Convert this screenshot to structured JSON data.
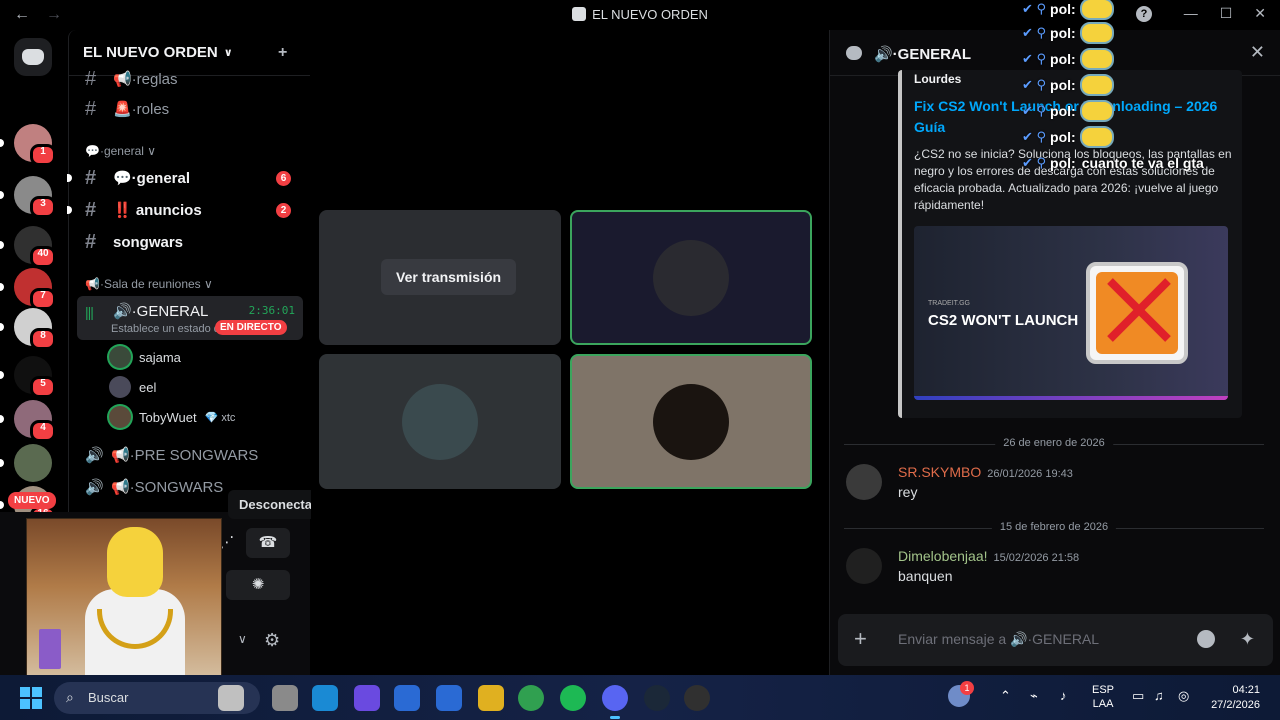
{
  "window": {
    "title": "EL NUEVO ORDEN",
    "back": "←",
    "forward": "→",
    "help": "?",
    "minimize": "—",
    "maximize": "☐",
    "close": "✕"
  },
  "rail": {
    "servers": [
      {
        "badge": "",
        "color": "#5865f2"
      },
      {
        "badge": "1",
        "color": "#c08080"
      },
      {
        "badge": "3",
        "color": "#8a8a8a"
      },
      {
        "badge": "40",
        "color": "#303030"
      },
      {
        "badge": "7",
        "color": "#c03030"
      },
      {
        "badge": "8",
        "color": "#d0d0d0"
      },
      {
        "badge": "5",
        "color": "#101010"
      },
      {
        "badge": "4",
        "color": "#8f6a7a"
      },
      {
        "badge": "",
        "color": "#5a6a50"
      },
      {
        "badge": "16",
        "color": "#a09080"
      }
    ],
    "new_label": "NUEVO"
  },
  "sidebar": {
    "server_name": "EL NUEVO ORDEN",
    "chevron": "∨",
    "invite_icon": "+",
    "channels_top": [
      {
        "icon": "#",
        "name": "📢·reglas"
      },
      {
        "icon": "#",
        "name": "🚨·roles"
      }
    ],
    "category_general": "💬·general ∨",
    "channels_general": [
      {
        "icon": "#",
        "name": "💬·general",
        "count": "6"
      },
      {
        "icon": "#",
        "name": "‼️ anuncios",
        "count": "2"
      },
      {
        "icon": "#",
        "name": "songwars",
        "count": ""
      }
    ],
    "category_sala": "📢·Sala de reuniones ∨",
    "voice_active": {
      "bars": "|||",
      "name": "🔊·GENERAL",
      "status": "Establece un estado de canal ✎",
      "time": "2:36:01"
    },
    "members": [
      {
        "name": "sajama",
        "color": "#3a4a3a"
      },
      {
        "name": "eel",
        "color": "#4a4a5a"
      },
      {
        "name": "TobyWuet",
        "color": "#5a4a3a"
      }
    ],
    "live_label": "EN DIRECTO",
    "toby_tag": "💎 xtc",
    "voice_others": [
      {
        "icon": "🔊",
        "name": "📢·PRE SONGWARS"
      },
      {
        "icon": "🔊",
        "name": "📢·SONGWARS"
      }
    ]
  },
  "tooltip": "Desconectar",
  "panel": {
    "soundboard_icon": "⋰",
    "disconnect_icon": "☎",
    "activity_icon": "✺",
    "settings_icon": "⚙",
    "arrow_icon": "∨"
  },
  "stage": {
    "watch_label": "Ver transmisión",
    "tiles": [
      {
        "bg": "#2b2d31",
        "avatar": "",
        "active": false,
        "watch": true
      },
      {
        "bg": "#1a1a2e",
        "avatar": "#2a2a30",
        "active": true,
        "watch": false
      },
      {
        "bg": "#2f3336",
        "avatar": "#3a4a4e",
        "active": false,
        "watch": false
      },
      {
        "bg": "#7f7468",
        "avatar": "#1a1410",
        "active": true,
        "watch": false
      }
    ]
  },
  "chat": {
    "header_name": "🔊·GENERAL",
    "close_icon": "✕",
    "embed": {
      "author": "Lourdes",
      "title": "Fix CS2 Won't Launch or Downloading – 2026 Guía",
      "description": "¿CS2 no se inicia? Soluciona los bloqueos, las pantallas en negro y los errores de descarga con estas soluciones de eficacia probada. Actualizado para 2026: ¡vuelve al juego rápidamente!",
      "image_brand": "TRADEIT.GG",
      "image_text": "CS2 WON'T LAUNCH"
    },
    "divider1": "26 de enero de 2026",
    "divider2": "15 de febrero de 2026",
    "messages": [
      {
        "user": "SR.SKYMBO",
        "ts": "26/01/2026 19:43",
        "text": "rey",
        "color": "#e06c4a"
      },
      {
        "user": "Dimelobenjaa!",
        "ts": "15/02/2026 21:58",
        "text": "banquen",
        "color": "#a3c48a"
      }
    ],
    "composer_placeholder": "Enviar mensaje a 🔊·GENERAL",
    "plus_icon": "+",
    "apps_icon": "✦"
  },
  "overlay": {
    "user": "pol",
    "lines": [
      "",
      "",
      "",
      "",
      "",
      "",
      "cuanto te va el gta"
    ]
  },
  "taskbar": {
    "search_label": "Buscar",
    "search_icon": "⌕",
    "apps": [
      "#c0c0c0",
      "#8a8a8a",
      "#1a8ad4",
      "#6a4ae0",
      "#2a6ad4",
      "#2a6ad4",
      "#e0b020",
      "#30a050",
      "#1db954",
      "#5865f2",
      "#1b2838",
      "#303030"
    ],
    "weather_badge": "1",
    "lang": "ESP\nLAA",
    "time": "04:21",
    "date": "27/2/2026"
  }
}
